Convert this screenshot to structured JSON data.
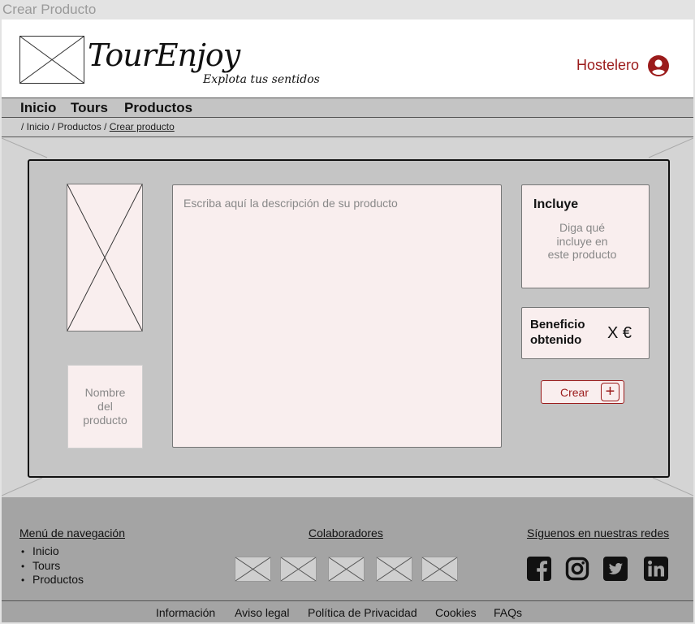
{
  "window": {
    "title": "Crear Producto"
  },
  "header": {
    "brand_name": "TourEnjoy",
    "brand_tagline": "Explota tus sentidos",
    "user_label": "Hostelero",
    "user_icon": "user-circle-icon",
    "accent_color": "#9b1b1b"
  },
  "nav": {
    "items": [
      "Inicio",
      "Tours",
      "Productos"
    ]
  },
  "breadcrumb": {
    "prefix": "/ ",
    "items": [
      "Inicio",
      "Productos"
    ],
    "separator": " / ",
    "current": "Crear producto"
  },
  "form": {
    "name_placeholder": "Nombre del producto",
    "description_placeholder": "Escriba aquí la descripción de su producto",
    "includes_title": "Incluye",
    "includes_placeholder": "Diga qué incluye en este producto",
    "benefit_label": "Beneficio obtenido",
    "benefit_value": "X €",
    "create_label": "Crear",
    "create_icon": "plus-icon"
  },
  "footer": {
    "nav_heading": "Menú de navegación",
    "nav_items": [
      "Inicio",
      "Tours",
      "Productos"
    ],
    "partners_heading": "Colaboradores",
    "partners_count": 5,
    "social_heading": "Síguenos en nuestras redes",
    "social_icons": [
      "facebook-icon",
      "instagram-icon",
      "twitter-icon",
      "linkedin-icon"
    ],
    "links": [
      "Información",
      "Aviso legal",
      "Política de Privacidad",
      "Cookies",
      "FAQs"
    ]
  }
}
